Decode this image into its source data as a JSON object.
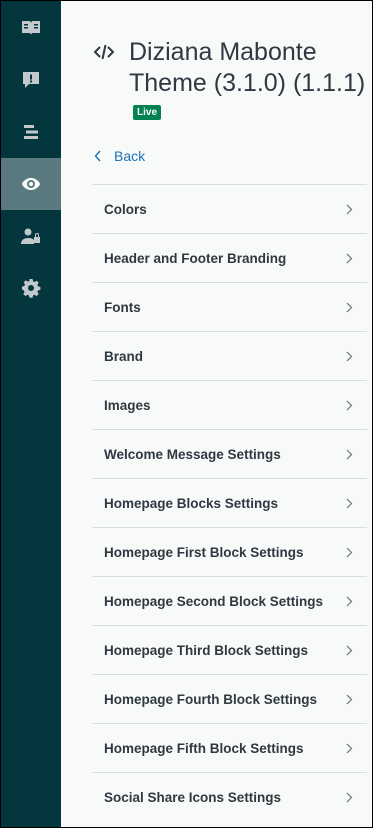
{
  "rail": {
    "items": [
      {
        "icon": "book-icon",
        "active": false
      },
      {
        "icon": "alert-message-icon",
        "active": false
      },
      {
        "icon": "align-bars-icon",
        "active": false
      },
      {
        "icon": "eye-icon",
        "active": true
      },
      {
        "icon": "user-lock-icon",
        "active": false
      },
      {
        "icon": "gear-icon",
        "active": false
      }
    ]
  },
  "header": {
    "title": "Diziana Mabonte Theme (3.1.0) (1.1.1)",
    "badge": "Live",
    "code_icon": "code-icon"
  },
  "back": {
    "label": "Back",
    "icon": "chevron-left-icon"
  },
  "menu": {
    "items": [
      {
        "label": "Colors"
      },
      {
        "label": "Header and Footer Branding"
      },
      {
        "label": "Fonts"
      },
      {
        "label": "Brand"
      },
      {
        "label": "Images"
      },
      {
        "label": "Welcome Message Settings"
      },
      {
        "label": "Homepage Blocks Settings"
      },
      {
        "label": "Homepage First Block Settings"
      },
      {
        "label": "Homepage Second Block Settings"
      },
      {
        "label": "Homepage Third Block Settings"
      },
      {
        "label": "Homepage Fourth Block Settings"
      },
      {
        "label": "Homepage Fifth Block Settings"
      },
      {
        "label": "Social Share Icons Settings"
      }
    ]
  },
  "colors": {
    "rail_bg": "#03363d",
    "rail_active": "#5a7a7f",
    "live_badge": "#038153",
    "link": "#1f73b7"
  }
}
